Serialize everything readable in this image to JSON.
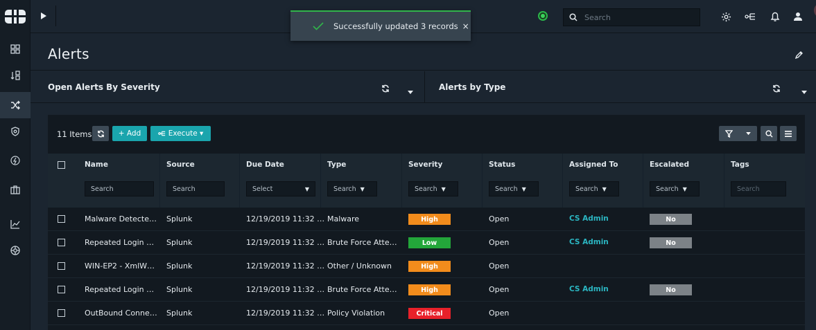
{
  "toast": {
    "message": "Successfully updated 3 records",
    "close": "×"
  },
  "topbar": {
    "search_placeholder": "Search"
  },
  "page": {
    "title": "Alerts"
  },
  "widgets": [
    {
      "title": "Open Alerts By Severity"
    },
    {
      "title": "Alerts by Type"
    }
  ],
  "grid": {
    "count_label": "11 Items",
    "add_label": "+ Add",
    "execute_label": "Execute ▾",
    "columns": [
      {
        "label": "Name",
        "filter": "Search",
        "dropdown": false
      },
      {
        "label": "Source",
        "filter": "Search",
        "dropdown": false
      },
      {
        "label": "Due Date",
        "filter": "Select",
        "dropdown": true
      },
      {
        "label": "Type",
        "filter": "Search",
        "dropdown": true
      },
      {
        "label": "Severity",
        "filter": "Search",
        "dropdown": true
      },
      {
        "label": "Status",
        "filter": "Search",
        "dropdown": true
      },
      {
        "label": "Assigned To",
        "filter": "Search",
        "dropdown": true
      },
      {
        "label": "Escalated",
        "filter": "Search",
        "dropdown": true
      },
      {
        "label": "Tags",
        "filter": "Search",
        "dropdown": false
      }
    ],
    "rows": [
      {
        "name": "Malware Detecte…",
        "source": "Splunk",
        "due": "12/19/2019 11:32 …",
        "type": "Malware",
        "severity": "High",
        "status": "Open",
        "assigned": "CS Admin",
        "escalated": "No"
      },
      {
        "name": "Repeated Login …",
        "source": "Splunk",
        "due": "12/19/2019 11:32 …",
        "type": "Brute Force Atte…",
        "severity": "Low",
        "status": "Open",
        "assigned": "CS Admin",
        "escalated": "No"
      },
      {
        "name": "WIN-EP2 - XmlW…",
        "source": "Splunk",
        "due": "12/19/2019 11:32 …",
        "type": "Other / Unknown",
        "severity": "High",
        "status": "Open",
        "assigned": "",
        "escalated": ""
      },
      {
        "name": "Repeated Login …",
        "source": "Splunk",
        "due": "12/19/2019 11:32 …",
        "type": "Brute Force Atte…",
        "severity": "High",
        "status": "Open",
        "assigned": "CS Admin",
        "escalated": "No"
      },
      {
        "name": "OutBound Conne…",
        "source": "Splunk",
        "due": "12/19/2019 11:32 …",
        "type": "Policy Violation",
        "severity": "Critical",
        "status": "Open",
        "assigned": "",
        "escalated": ""
      }
    ]
  },
  "colors": {
    "High": "#f28c1c",
    "Low": "#23a63a",
    "Critical": "#e8212a",
    "accent": "#1aa5ad",
    "escalated": "#7c8287"
  },
  "rail_icons": [
    "dashboard-icon",
    "queue-icon",
    "shuffle-icon",
    "shield-icon",
    "bolt-icon",
    "briefcase-icon",
    "chart-icon",
    "settings-wheel-icon"
  ]
}
